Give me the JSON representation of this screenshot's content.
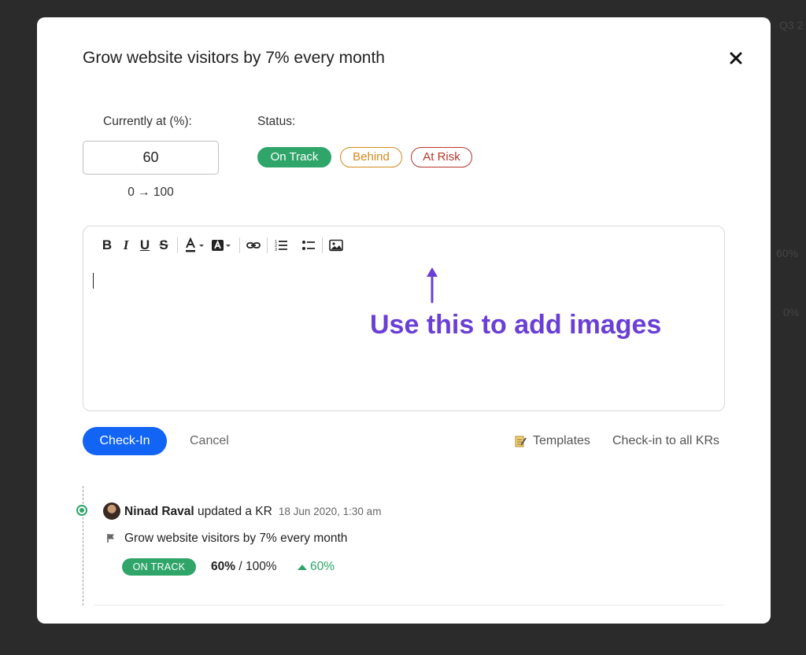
{
  "background": {
    "texts": [
      "Q3 2",
      "60%",
      "0%"
    ]
  },
  "modal": {
    "title": "Grow website visitors by 7% every month",
    "close_icon": "close-icon"
  },
  "current": {
    "label": "Currently at (%):",
    "value": "60",
    "range": "0 → 100"
  },
  "status": {
    "label": "Status:",
    "options": [
      {
        "label": "On Track",
        "color": "#2fa56a",
        "selected": true
      },
      {
        "label": "Behind",
        "color": "#d48a1e",
        "selected": false
      },
      {
        "label": "At Risk",
        "color": "#b8352b",
        "selected": false
      }
    ]
  },
  "editor": {
    "toolbar": [
      {
        "icon": "bold-icon",
        "glyph": "B"
      },
      {
        "icon": "italic-icon",
        "glyph": "I"
      },
      {
        "icon": "underline-icon",
        "glyph": "U"
      },
      {
        "icon": "strikethrough-icon",
        "glyph": "S"
      },
      {
        "icon": "text-color-icon"
      },
      {
        "icon": "highlight-color-icon"
      },
      {
        "icon": "link-icon"
      },
      {
        "icon": "ordered-list-icon"
      },
      {
        "icon": "bullet-list-icon"
      },
      {
        "icon": "image-icon"
      }
    ],
    "annotation": "Use this to add images",
    "annotation_color": "#6a3fd6"
  },
  "actions": {
    "checkin_label": "Check-In",
    "cancel_label": "Cancel",
    "templates_label": "Templates",
    "checkin_all_label": "Check-in to all KRs",
    "primary_color": "#1264f5"
  },
  "feed": {
    "user": "Ninad Raval",
    "action": " updated a KR",
    "time": "18 Jun 2020, 1:30 am",
    "kr_name": "Grow website visitors by 7% every month",
    "badge": "ON TRACK",
    "current": "60%",
    "target": " / 100%",
    "delta": "60%"
  }
}
